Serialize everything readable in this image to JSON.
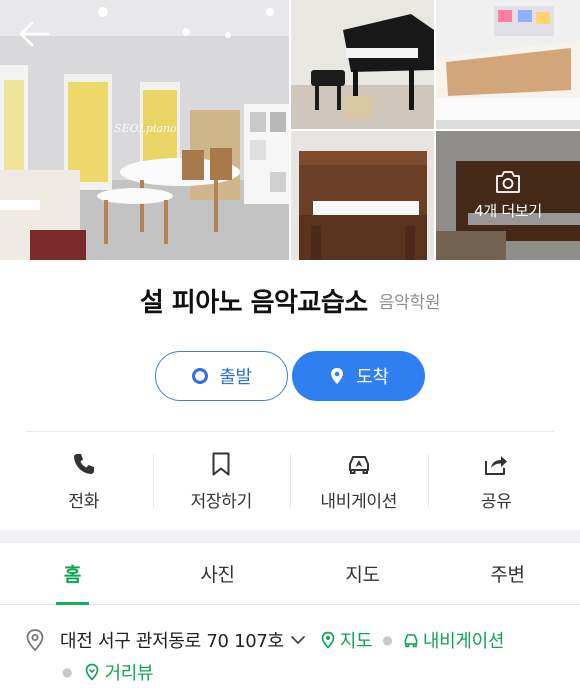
{
  "gallery": {
    "watermark": "SEOLpiano",
    "more_label": "4개 더보기",
    "back_icon": "arrow-left-icon",
    "camera_icon": "camera-icon"
  },
  "place": {
    "name": "설 피아노 음악교습소",
    "category": "음악학원"
  },
  "route": {
    "start_label": "출발",
    "dest_label": "도착",
    "accent": "#2f7ff0"
  },
  "actions": [
    {
      "label": "전화",
      "icon": "phone-icon"
    },
    {
      "label": "저장하기",
      "icon": "bookmark-icon"
    },
    {
      "label": "내비게이션",
      "icon": "car-navigation-icon"
    },
    {
      "label": "공유",
      "icon": "share-icon"
    }
  ],
  "tabs": [
    {
      "label": "홈",
      "active": true
    },
    {
      "label": "사진",
      "active": false
    },
    {
      "label": "지도",
      "active": false
    },
    {
      "label": "주변",
      "active": false
    }
  ],
  "address": {
    "text": "대전 서구 관저동로 70 107호",
    "map_link": "지도",
    "navi_link": "내비게이션",
    "street_link": "거리뷰",
    "link_color": "#11a451"
  }
}
